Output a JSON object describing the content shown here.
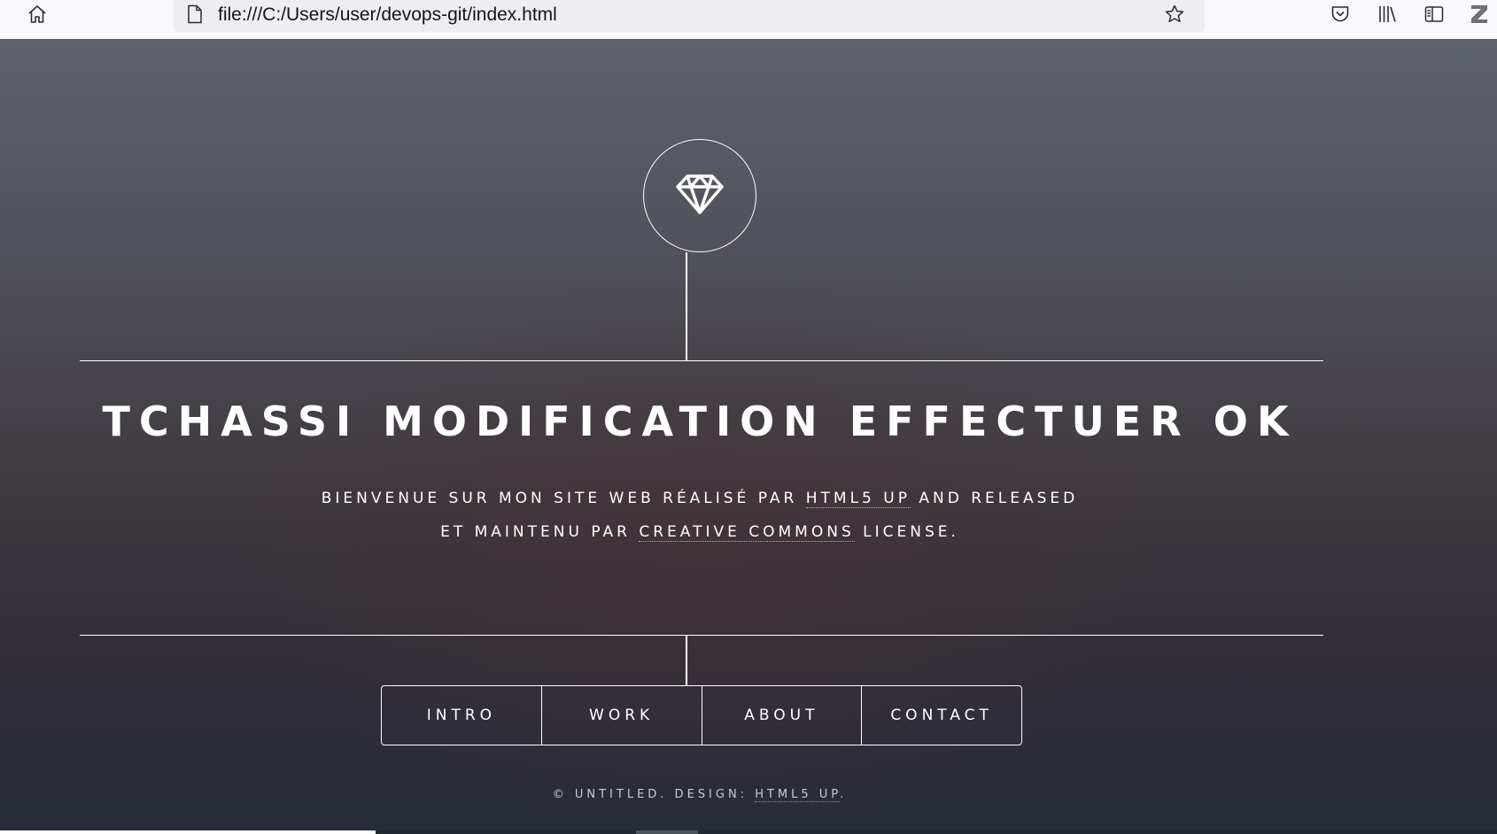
{
  "browser": {
    "url": "file:///C:/Users/user/devops-git/index.html"
  },
  "icons": {
    "home": "home-icon",
    "page": "page-icon",
    "bookmark": "star-icon",
    "pocket": "pocket-icon",
    "library": "library-icon",
    "sidebar": "sidebar-icon",
    "extension": "extension-z-icon",
    "logo": "diamond-icon"
  },
  "header": {
    "title": "TCHASSI MODIFICATION EFFECTUER OK",
    "line1_prefix": "BIENVENUE SUR MON SITE WEB RÉALISÉ PAR ",
    "line1_link": "HTML5 UP",
    "line1_suffix": " AND RELEASED",
    "line2_prefix": "ET MAINTENU PAR ",
    "line2_link": "CREATIVE COMMONS",
    "line2_suffix": " LICENSE."
  },
  "nav": {
    "items": [
      {
        "label": "INTRO"
      },
      {
        "label": "WORK"
      },
      {
        "label": "ABOUT"
      },
      {
        "label": "CONTACT"
      }
    ]
  },
  "footer": {
    "prefix": "© UNTITLED. DESIGN: ",
    "link": "HTML5 UP",
    "suffix": "."
  },
  "colors": {
    "accent": "#ffffff",
    "toolbar_bg": "#f9f9fb",
    "urlbar_bg": "#eeeef2",
    "page_top": "#5e626d",
    "page_bottom": "#272b39"
  }
}
